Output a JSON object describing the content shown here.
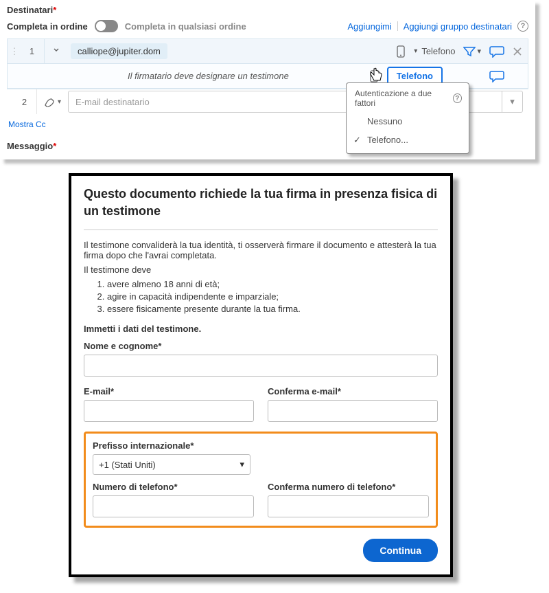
{
  "panel": {
    "recipients_label": "Destinatari",
    "complete_order_label": "Completa in ordine",
    "complete_any_order": "Completa in qualsiasi ordine",
    "add_me": "Aggiungimi",
    "add_group": "Aggiungi gruppo destinatari",
    "row1": {
      "num": "1",
      "email": "calliope@jupiter.dom",
      "phone": "Telefono",
      "witness_text": "Il firmatario deve designare un testimone",
      "phone2": "Telefono"
    },
    "row2": {
      "num": "2",
      "placeholder": "E-mail destinatario"
    },
    "show_cc": "Mostra Cc",
    "message_label": "Messaggio",
    "dropdown": {
      "header": "Autenticazione a due fattori",
      "opt_none": "Nessuno",
      "opt_phone": "Telefono..."
    }
  },
  "modal": {
    "title": "Questo documento richiede la tua firma in presenza fisica di un testimone",
    "p1": "Il testimone convaliderà la tua identità, ti osserverà firmare il documento e attesterà la tua firma dopo che l'avrai completata.",
    "p2": "Il testimone deve",
    "li1": "avere almeno 18 anni di età;",
    "li2": "agire in capacità indipendente e imparziale;",
    "li3": "essere fisicamente presente durante la tua firma.",
    "intro": "Immetti i dati del testimone.",
    "name_label": "Nome e cognome",
    "email_label": "E-mail",
    "confirm_email_label": "Conferma e-mail",
    "intl_prefix_label": "Prefisso internazionale",
    "intl_prefix_value": "+1 (Stati Uniti)",
    "phone_label": "Numero di telefono",
    "confirm_phone_label": "Conferma numero di telefono",
    "continue": "Continua"
  }
}
